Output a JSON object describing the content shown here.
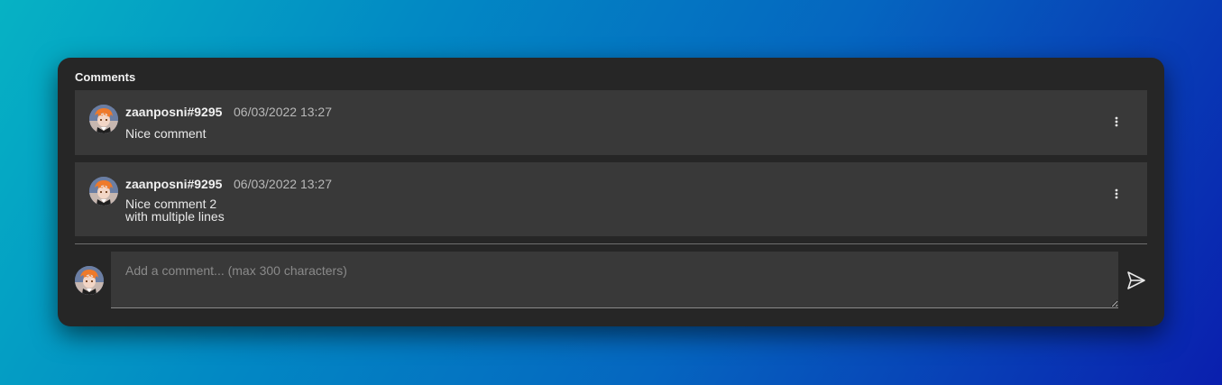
{
  "panel": {
    "title": "Comments"
  },
  "comments": [
    {
      "author": "zaanposni#9295",
      "date": "06/03/2022 13:27",
      "lines": [
        "Nice comment"
      ],
      "menu_icon": "more-vertical-icon"
    },
    {
      "author": "zaanposni#9295",
      "date": "06/03/2022 13:27",
      "lines": [
        "Nice comment 2",
        "with multiple lines"
      ],
      "menu_icon": "more-vertical-icon"
    }
  ],
  "composer": {
    "placeholder": "Add a comment... (max 300 characters)",
    "value": "",
    "send_icon": "send-icon"
  },
  "colors": {
    "panel_bg": "#262626",
    "card_bg": "#393939",
    "text": "#f0f0f0",
    "muted": "#b8b8b8"
  }
}
